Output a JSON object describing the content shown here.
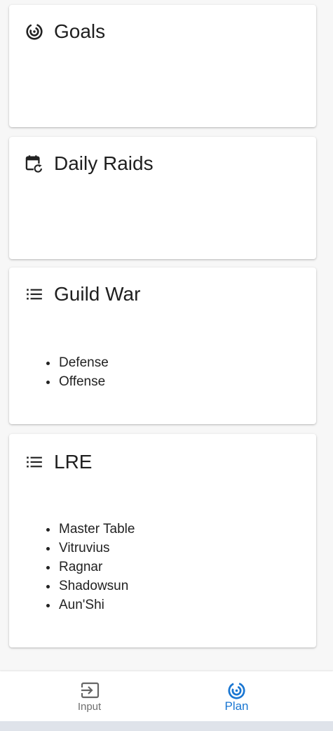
{
  "cards": [
    {
      "title": "Goals",
      "icon": "goals-target-icon",
      "items": []
    },
    {
      "title": "Daily Raids",
      "icon": "calendar-refresh-icon",
      "items": []
    },
    {
      "title": "Guild War",
      "icon": "list-icon",
      "items": [
        "Defense",
        "Offense"
      ]
    },
    {
      "title": "LRE",
      "icon": "list-icon",
      "items": [
        "Master Table",
        "Vitruvius",
        "Ragnar",
        "Shadowsun",
        "Aun'Shi"
      ]
    }
  ],
  "bottom_nav": {
    "items": [
      {
        "label": "Input",
        "icon": "input-icon",
        "active": false
      },
      {
        "label": "Plan",
        "icon": "plan-target-icon",
        "active": true
      }
    ]
  },
  "colors": {
    "accent": "#1976d2",
    "inactive": "#6f6f6f",
    "text": "#1f1f1f"
  }
}
